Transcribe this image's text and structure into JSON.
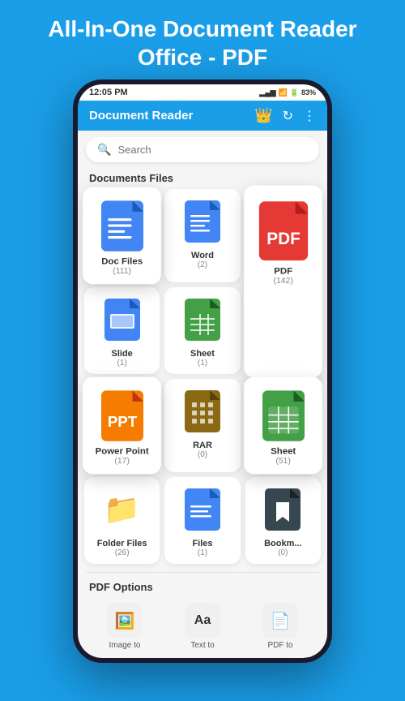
{
  "app": {
    "header": "All-In-One Document Reader Office - PDF",
    "title": "Document Reader",
    "search_placeholder": "Search",
    "crown_icon": "👑",
    "refresh_icon": "↻",
    "more_icon": "⋮"
  },
  "status_bar": {
    "time": "12:05 PM",
    "signal": "▂▄▆",
    "wifi_icon": "wifi",
    "battery": "83"
  },
  "sections": {
    "documents_title": "Documents Files",
    "pdf_options_title": "PDF Options"
  },
  "document_cards": [
    {
      "id": "doc",
      "label": "Doc Files",
      "count": "(111)",
      "color": "blue",
      "type": "doc",
      "elevated": true
    },
    {
      "id": "word",
      "label": "Word",
      "count": "(2)",
      "color": "blue",
      "type": "word"
    },
    {
      "id": "pdf",
      "label": "PDF",
      "count": "(142)",
      "color": "red",
      "type": "pdf",
      "elevated": true
    },
    {
      "id": "slide",
      "label": "Slide",
      "count": "(1)",
      "color": "blue",
      "type": "slide"
    },
    {
      "id": "sheet_small",
      "label": "Sheet",
      "count": "(1)",
      "color": "green",
      "type": "sheet_small"
    },
    {
      "id": "powerpoint",
      "label": "Power Point",
      "count": "(17)",
      "color": "orange",
      "type": "ppt",
      "elevated": true
    },
    {
      "id": "rar",
      "label": "RAR",
      "count": "(0)",
      "color": "brown",
      "type": "rar"
    },
    {
      "id": "sheet_large",
      "label": "Sheet",
      "count": "(51)",
      "color": "green",
      "type": "sheet",
      "elevated": true
    },
    {
      "id": "folder",
      "label": "Folder Files",
      "count": "(26)",
      "color": "yellow",
      "type": "folder"
    },
    {
      "id": "files",
      "label": "Files",
      "count": "(1)",
      "color": "blue",
      "type": "files"
    },
    {
      "id": "bookmark",
      "label": "Bookm...",
      "count": "(0)",
      "color": "dark",
      "type": "bookmark"
    }
  ],
  "pdf_options": [
    {
      "id": "image_to",
      "label": "Image to",
      "icon": "🖼️"
    },
    {
      "id": "text_to",
      "label": "Text to",
      "icon": "Aa"
    },
    {
      "id": "pdf_to",
      "label": "PDF to",
      "icon": "📄"
    }
  ]
}
